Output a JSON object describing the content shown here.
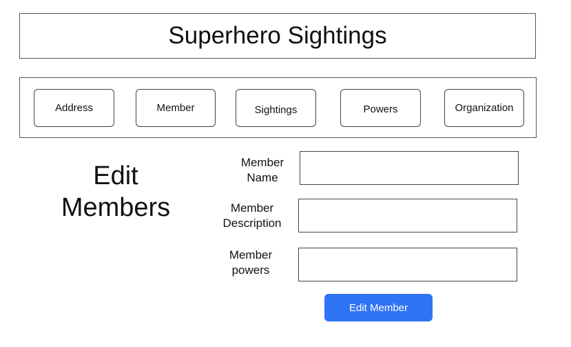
{
  "header": {
    "title": "Superhero Sightings"
  },
  "nav": {
    "items": [
      {
        "label": "Address"
      },
      {
        "label": "Member"
      },
      {
        "label": "Sightings"
      },
      {
        "label": "Powers"
      },
      {
        "label": "Organization"
      }
    ]
  },
  "page": {
    "heading_line1": "Edit",
    "heading_line2": "Members"
  },
  "form": {
    "name_label_1": "Member",
    "name_label_2": "Name",
    "name_value": "",
    "description_label_1": "Member",
    "description_label_2": "Description",
    "description_value": "",
    "powers_label_1": "Member",
    "powers_label_2": "powers",
    "powers_value": "",
    "submit_label": "Edit Member"
  },
  "colors": {
    "primary_button": "#2f74f5",
    "border": "#444444"
  }
}
